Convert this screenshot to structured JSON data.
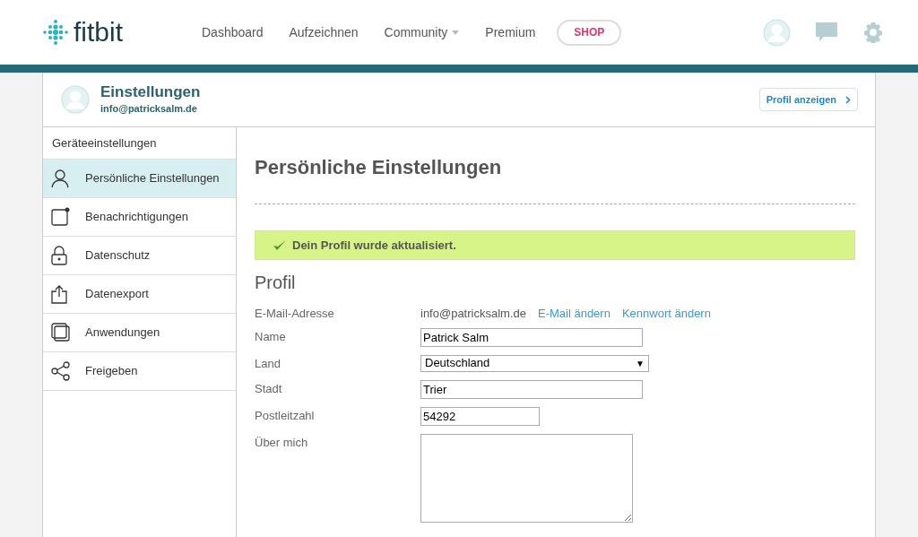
{
  "nav": {
    "logo": "fitbit",
    "links": [
      {
        "label": "Dashboard",
        "dropdown": false
      },
      {
        "label": "Aufzeichnen",
        "dropdown": false
      },
      {
        "label": "Community",
        "dropdown": true
      },
      {
        "label": "Premium",
        "dropdown": false
      }
    ],
    "shop": "SHOP"
  },
  "profile_header": {
    "title": "Einstellungen",
    "email": "info@patricksalm.de",
    "button": "Profil anzeigen"
  },
  "sidebar": {
    "items": [
      {
        "label": "Geräteeinstellungen",
        "selected": false
      },
      {
        "label": "Persönliche Einstellungen",
        "selected": true
      },
      {
        "label": "Benachrichtigungen",
        "selected": false
      },
      {
        "label": "Datenschutz",
        "selected": false
      },
      {
        "label": "Datenexport",
        "selected": false
      },
      {
        "label": "Anwendungen",
        "selected": false
      },
      {
        "label": "Freigeben",
        "selected": false
      }
    ]
  },
  "page_title": "Persönliche Einstellungen",
  "success_message": "Dein Profil wurde aktualisiert.",
  "section_title": "Profil",
  "fields": [
    {
      "kind": "email",
      "label": "E-Mail-Adresse",
      "value": "info@patricksalm.de",
      "links": [
        "E-Mail ändern",
        "Kennwort ändern"
      ]
    },
    {
      "kind": "text",
      "label": "Name",
      "value": "Patrick Salm"
    },
    {
      "kind": "select",
      "label": "Land",
      "value": "Deutschland",
      "arrow": "▼"
    },
    {
      "kind": "text",
      "label": "Stadt",
      "value": "Trier"
    },
    {
      "kind": "text",
      "label": "Postleitzahl",
      "value": "54292"
    },
    {
      "kind": "textarea",
      "label": "Über mich"
    }
  ]
}
